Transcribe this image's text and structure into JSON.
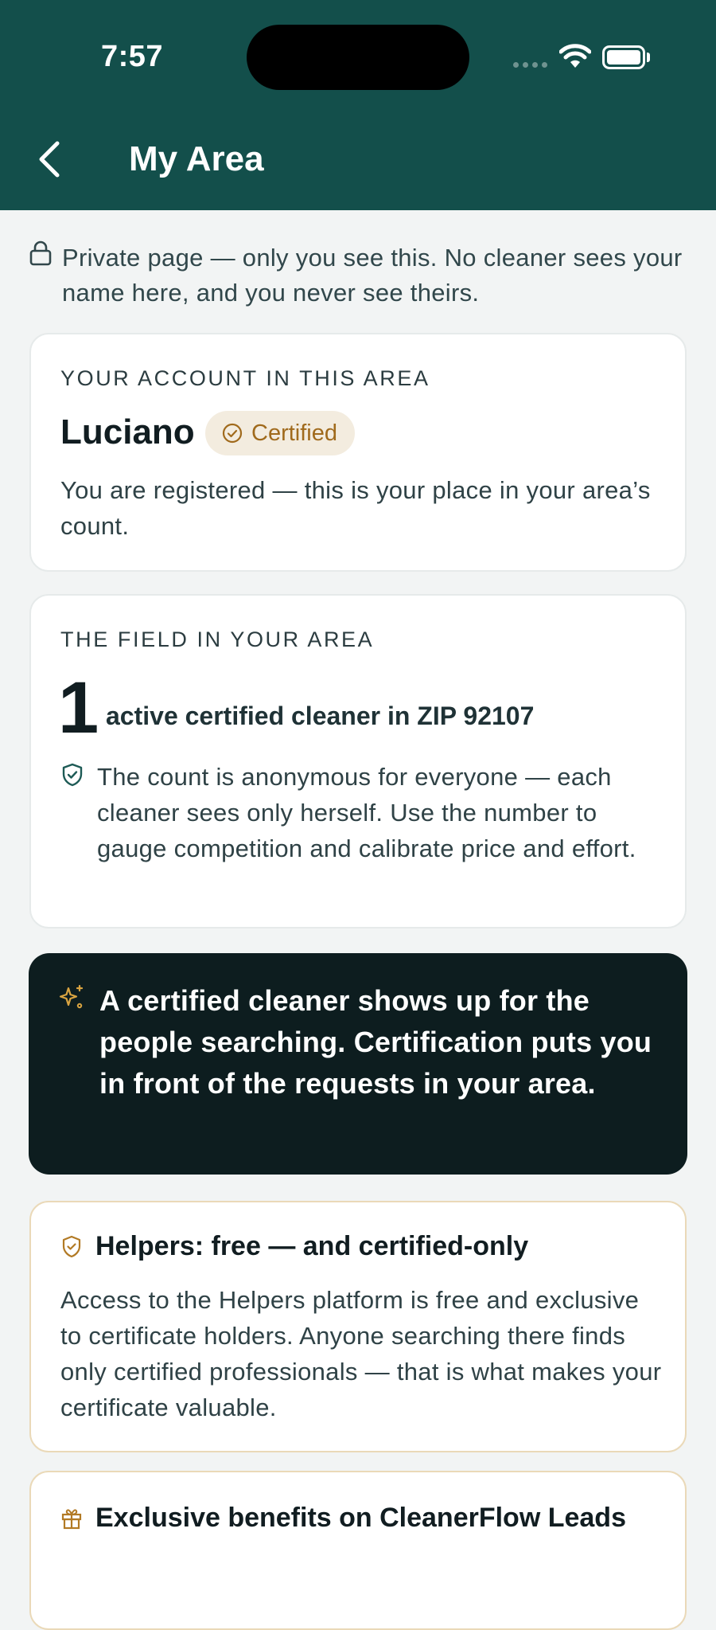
{
  "status_bar": {
    "time": "7:57"
  },
  "header": {
    "title": "My Area"
  },
  "privacy_note": "Private page — only you see this. No cleaner sees your name here, and you never see theirs.",
  "account_card": {
    "eyebrow": "YOUR ACCOUNT IN THIS AREA",
    "name": "Luciano",
    "badge": "Certified",
    "body": "You are registered — this is your place in your area’s count."
  },
  "field_card": {
    "eyebrow": "THE FIELD IN YOUR AREA",
    "count": "1",
    "count_label": "active certified cleaner in ZIP 92107",
    "note": "The count is anonymous for everyone — each cleaner sees only herself. Use the number to gauge competition and calibrate price and effort."
  },
  "promo": {
    "text": "A certified cleaner shows up for the people searching. Certification puts you in front of the requests in your area."
  },
  "helpers_card": {
    "title": "Helpers: free — and certified-only",
    "body": "Access to the Helpers platform is free and exclusive to certificate holders. Anyone searching there finds only certified professionals — that is what makes your certificate valuable."
  },
  "benefits_card": {
    "title": "Exclusive benefits on CleanerFlow Leads"
  },
  "colors": {
    "header_bg": "#134f4b",
    "badge_bg": "#f3ecdf",
    "badge_text": "#a06a1c",
    "dark_card": "#0d1d1f",
    "gold_border": "#ead9b8"
  },
  "icons": {
    "privacy": "lock-icon",
    "badge": "check-circle-icon",
    "note": "shield-check-icon",
    "promo": "sparkles-icon",
    "helpers": "shield-check-icon",
    "benefits": "gift-icon"
  }
}
